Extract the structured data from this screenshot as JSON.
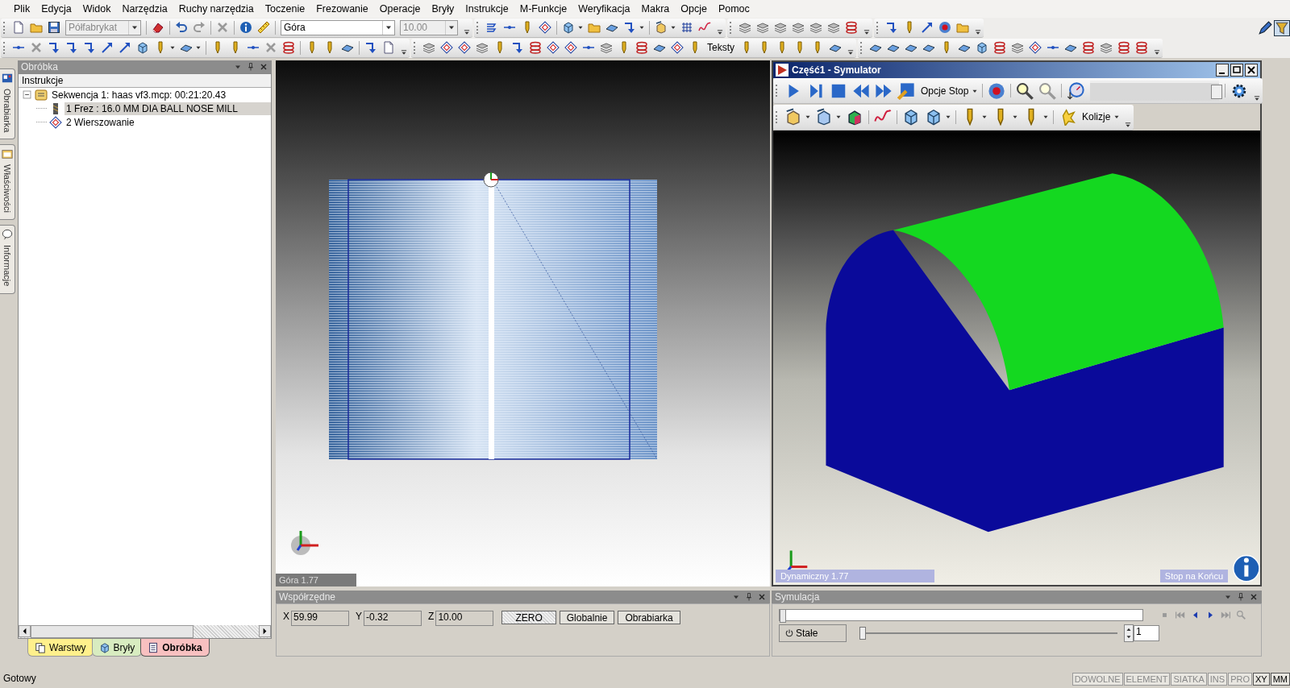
{
  "menu": [
    "Plik",
    "Edycja",
    "Widok",
    "Narzędzia",
    "Ruchy narzędzia",
    "Toczenie",
    "Frezowanie",
    "Operacje",
    "Bryły",
    "Instrukcje",
    "M-Funkcje",
    "Weryfikacja",
    "Makra",
    "Opcje",
    "Pomoc"
  ],
  "toolbar": {
    "combos": [
      {
        "value": "Półfabrykat",
        "disabled": true
      },
      {
        "value": "Góra",
        "disabled": false
      },
      {
        "value": "10.00",
        "disabled": true
      }
    ],
    "text_buttons": [
      "Teksty"
    ]
  },
  "side_tabs": [
    "Obrabiarka",
    "Właściwości",
    "Informacje"
  ],
  "operations_panel": {
    "title": "Obróbka",
    "column": "Instrukcje",
    "tree": [
      {
        "kind": "sequence",
        "label": "Sekwencja 1: haas vf3.mcp: 00:21:20.43",
        "expanded": true,
        "selected": false,
        "children": [
          {
            "kind": "tool",
            "label": "1 Frez : 16.0 MM DIA BALL NOSE MILL",
            "selected": true
          },
          {
            "kind": "operation",
            "label": "2 Wierszowanie",
            "selected": false
          }
        ]
      }
    ],
    "tabs": [
      {
        "label": "Warstwy",
        "color": "#fff08c",
        "selected": false
      },
      {
        "label": "Bryły",
        "color": "#d8ecc0",
        "selected": false
      },
      {
        "label": "Obróbka",
        "color": "#f8c0c0",
        "selected": true
      }
    ]
  },
  "viewport": {
    "view_label": "Góra 1.77"
  },
  "simulator": {
    "title": "Część1 - Symulator",
    "stop_options": "Opcje Stop",
    "speed_slider": {
      "level": 0.97
    },
    "collisions": "Kolizje",
    "view_label": "Dynamiczny 1.77",
    "stop_label": "Stop na Końcu"
  },
  "coordinates": {
    "title": "Współrzędne",
    "fields": [
      {
        "axis": "X",
        "value": "59.99"
      },
      {
        "axis": "Y",
        "value": "-0.32"
      },
      {
        "axis": "Z",
        "value": "10.00"
      }
    ],
    "buttons": [
      {
        "label": "ZERO",
        "selected": true
      },
      {
        "label": "Globalnie",
        "selected": false
      },
      {
        "label": "Obrabiarka",
        "selected": false
      }
    ]
  },
  "simulation": {
    "title": "Symulacja",
    "progress": {
      "level": 0
    },
    "mode_button": "Stałe",
    "speed_slider": {
      "level": 0
    },
    "step": "1"
  },
  "status_bar": {
    "text": "Gotowy",
    "indicators": [
      {
        "label": "DOWOLNE",
        "on": false
      },
      {
        "label": "ELEMENT",
        "on": false
      },
      {
        "label": "SIATKA",
        "on": false
      },
      {
        "label": "INS",
        "on": false
      },
      {
        "label": "PRO",
        "on": false
      },
      {
        "label": "XY",
        "on": true
      },
      {
        "label": "MM",
        "on": true
      }
    ]
  }
}
